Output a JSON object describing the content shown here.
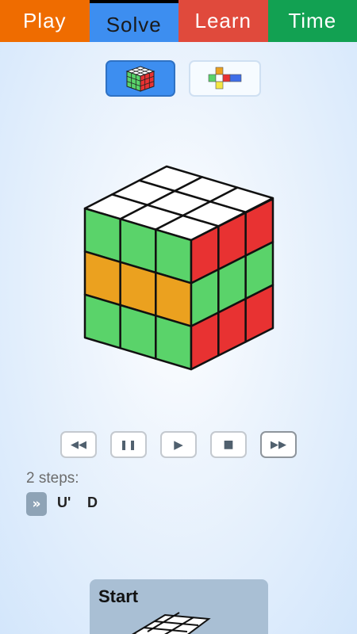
{
  "tabs": [
    "Play",
    "Solve",
    "Learn",
    "Time"
  ],
  "active_tab": "Solve",
  "view_modes": [
    "3d-cube-view",
    "2d-net-view"
  ],
  "cube": {
    "top": [
      "white",
      "white",
      "white",
      "white",
      "white",
      "white",
      "white",
      "white",
      "white"
    ],
    "front": [
      "green",
      "green",
      "green",
      "orange",
      "orange",
      "orange",
      "green",
      "green",
      "green"
    ],
    "right": [
      "red",
      "red",
      "red",
      "green",
      "green",
      "green",
      "red",
      "red",
      "red"
    ]
  },
  "colors": {
    "white": "#ffffff",
    "green": "#5ad36a",
    "orange": "#eba11f",
    "red": "#e83232",
    "play": "#ef6c00",
    "solve": "#3d8ef0",
    "learn": "#e04a3c",
    "time": "#12a152"
  },
  "playback": [
    "rewind-icon",
    "pause-icon",
    "play-icon",
    "stop-icon",
    "fast-forward-icon"
  ],
  "solution": {
    "steps_label": "2 steps:",
    "badge": "»",
    "moves": [
      "U'",
      "D"
    ]
  },
  "start_card": {
    "label": "Start"
  }
}
